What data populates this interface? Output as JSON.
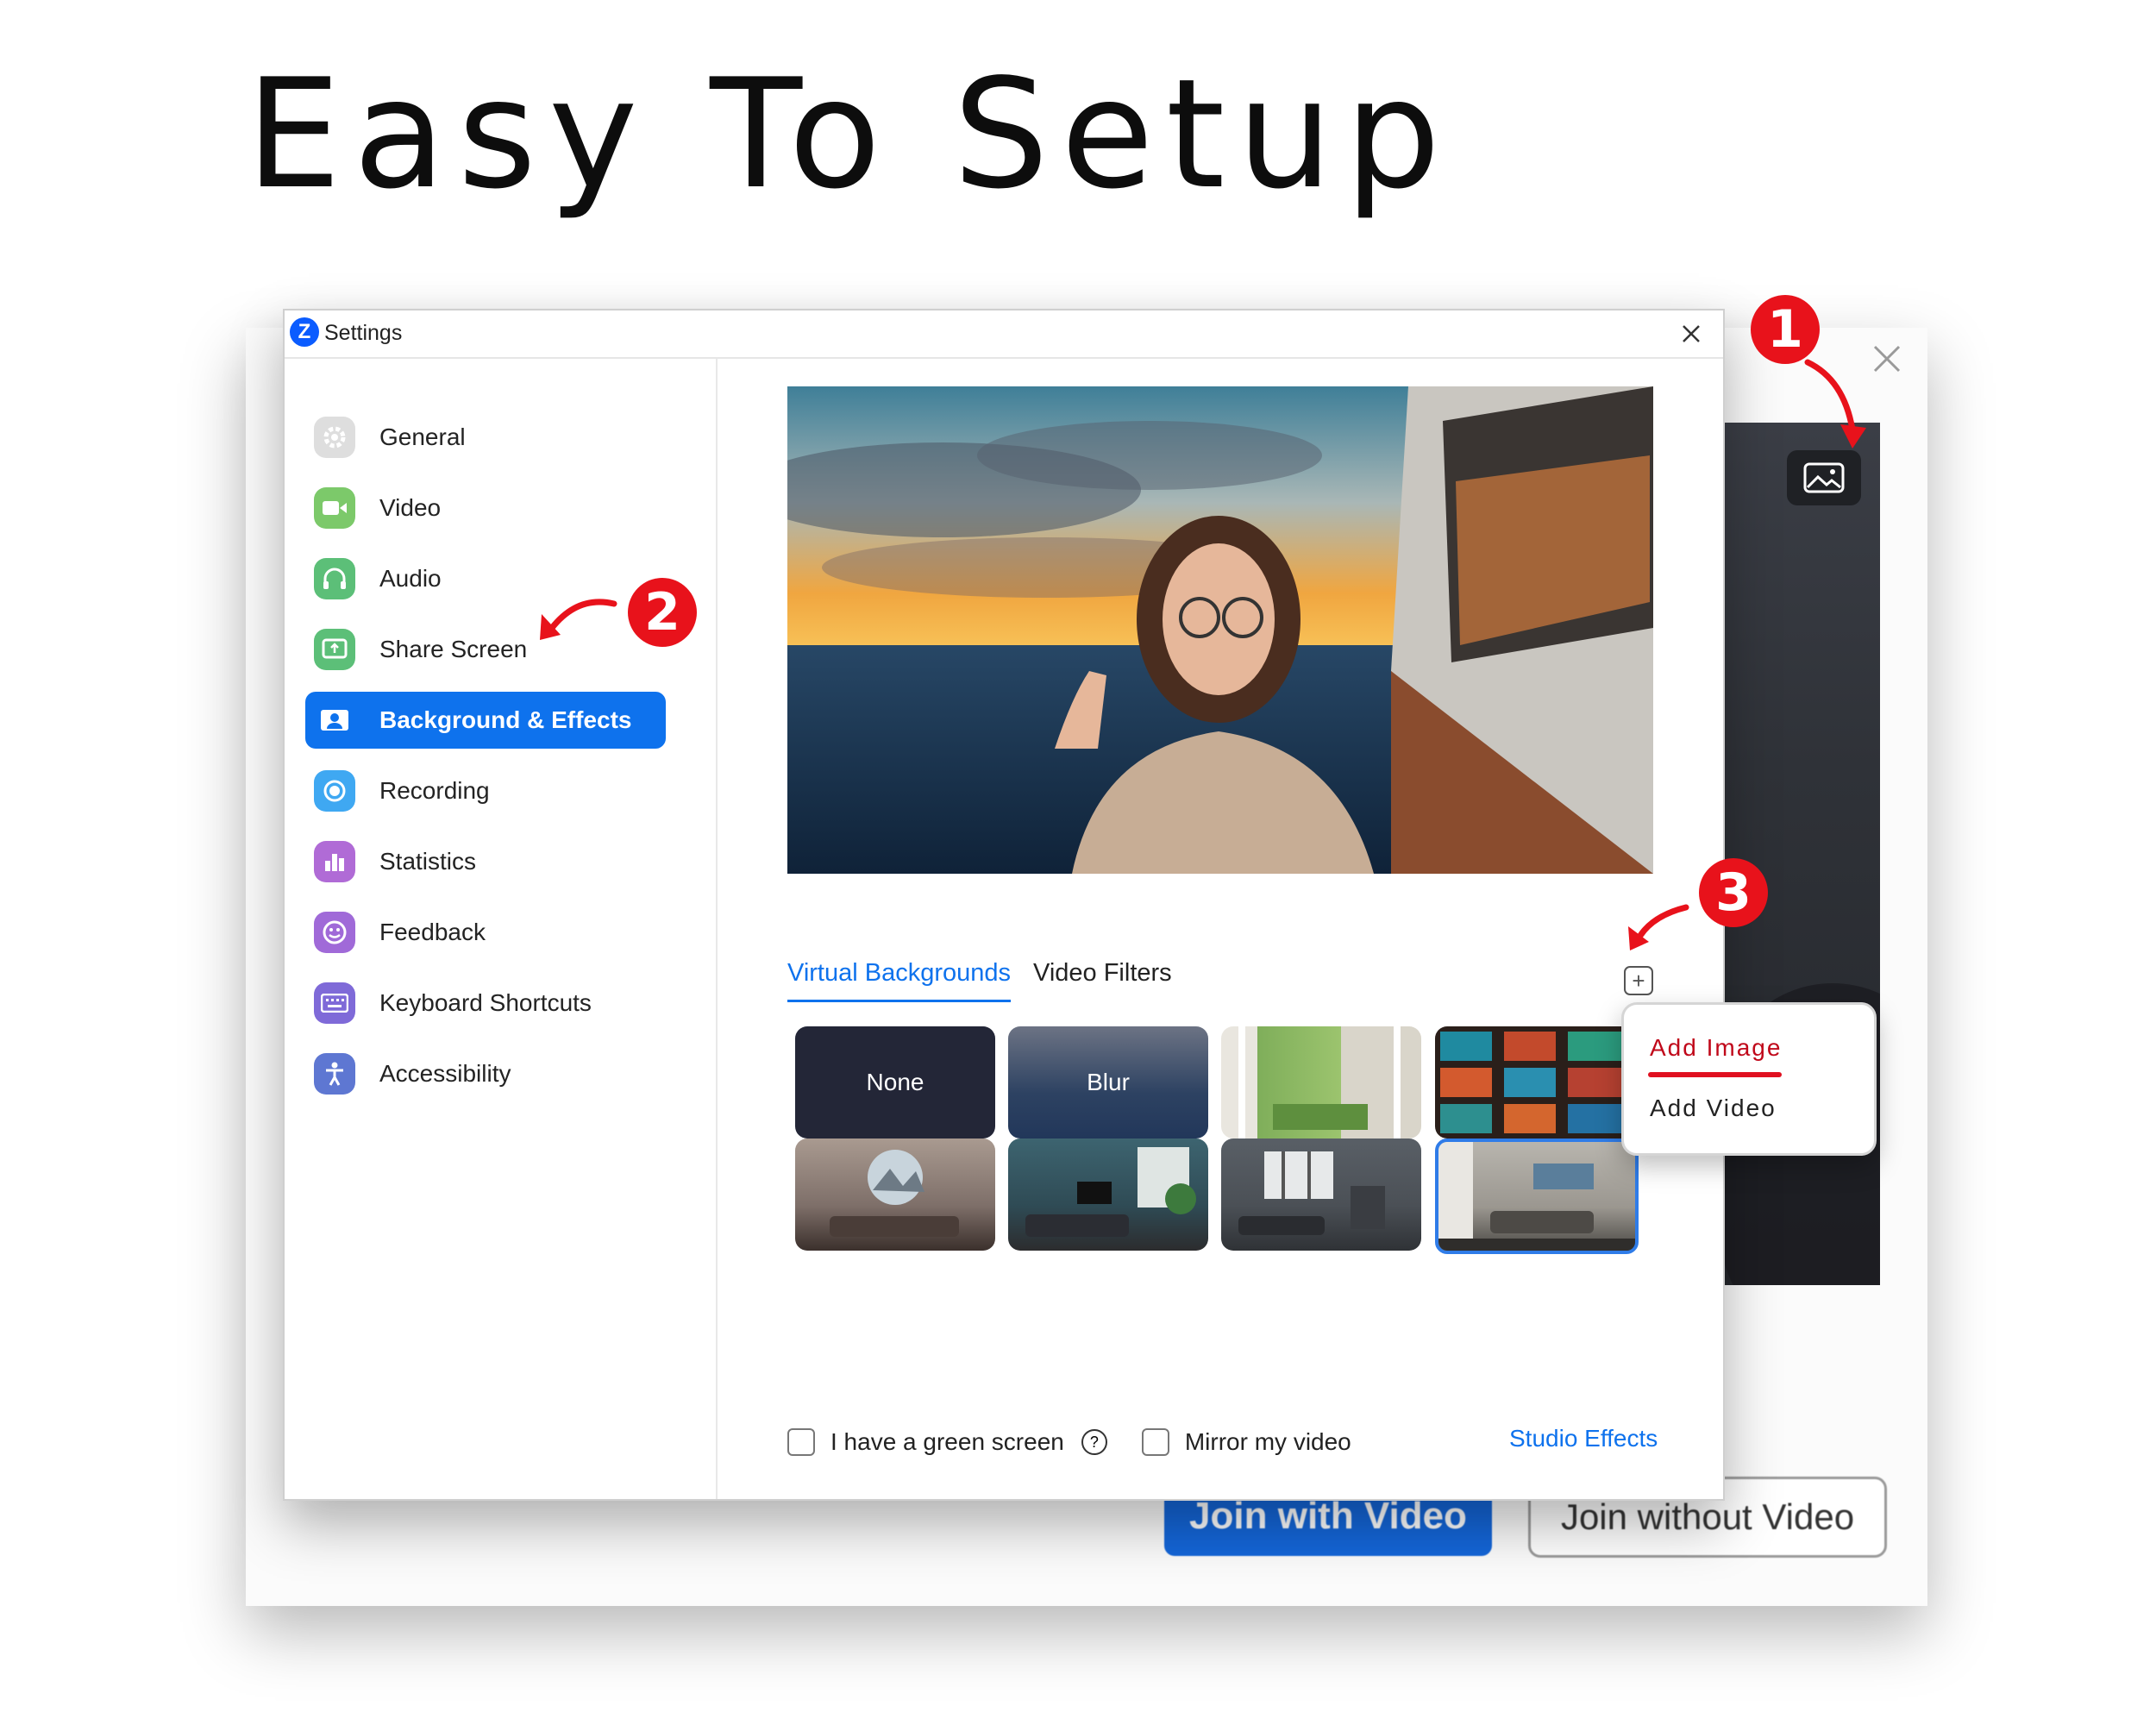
{
  "headline": "Easy To Setup",
  "settings_window": {
    "title": "Settings",
    "app_icon_letter": "Z",
    "nav": [
      {
        "label": "General",
        "icon": "gear-icon",
        "color": "#d9d9d9",
        "active": false
      },
      {
        "label": "Video",
        "icon": "video-camera-icon",
        "color": "#7cc96a",
        "active": false
      },
      {
        "label": "Audio",
        "icon": "headphones-icon",
        "color": "#5cbf78",
        "active": false
      },
      {
        "label": "Share Screen",
        "icon": "share-screen-icon",
        "color": "#5cbf78",
        "active": false
      },
      {
        "label": "Background & Effects",
        "icon": "person-badge-icon",
        "color": "#0e72ed",
        "active": true
      },
      {
        "label": "Recording",
        "icon": "record-icon",
        "color": "#3fa8f2",
        "active": false
      },
      {
        "label": "Statistics",
        "icon": "bar-chart-icon",
        "color": "#b06bd6",
        "active": false
      },
      {
        "label": "Feedback",
        "icon": "smiley-icon",
        "color": "#a06ad8",
        "active": false
      },
      {
        "label": "Keyboard Shortcuts",
        "icon": "keyboard-icon",
        "color": "#7f6ad8",
        "active": false
      },
      {
        "label": "Accessibility",
        "icon": "accessibility-icon",
        "color": "#5e77d2",
        "active": false
      }
    ],
    "tabs": {
      "virtual": "Virtual Backgrounds",
      "filters": "Video Filters"
    },
    "thumbnails": {
      "none": "None",
      "blur": "Blur"
    },
    "footer": {
      "green_screen": "I have a green screen",
      "mirror": "Mirror my video",
      "studio_effects": "Studio Effects"
    }
  },
  "popup": {
    "add_image": "Add Image",
    "add_video": "Add Video"
  },
  "join_window": {
    "join_with_video": "Join with Video",
    "join_without_video": "Join without Video"
  },
  "badges": {
    "one": "1",
    "two": "2",
    "three": "3"
  },
  "colors": {
    "accent": "#0e72ed",
    "badge_red": "#e8121b"
  }
}
